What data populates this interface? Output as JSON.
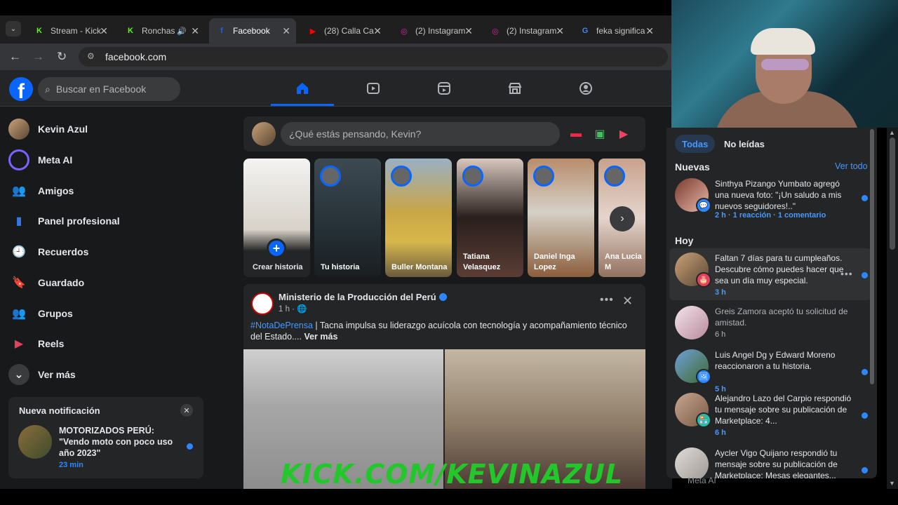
{
  "browser": {
    "tabs": [
      {
        "title": "Stream - Kick",
        "icon": "kick-icon",
        "icon_color": "#53fc18",
        "glyph": "K"
      },
      {
        "title": "Ronchas",
        "icon": "kick-icon",
        "icon_color": "#53fc18",
        "glyph": "K",
        "audio": "🔊"
      },
      {
        "title": "Facebook",
        "icon": "facebook-icon",
        "icon_color": "#0866ff",
        "glyph": "f"
      },
      {
        "title": "(28) Calla Ca",
        "icon": "youtube-icon",
        "icon_color": "#ff0000",
        "glyph": "▶"
      },
      {
        "title": "(2) Instagram",
        "icon": "instagram-icon",
        "icon_color": "#d6249f",
        "glyph": "◎"
      },
      {
        "title": "(2) Instagram",
        "icon": "instagram-icon",
        "icon_color": "#d6249f",
        "glyph": "◎"
      },
      {
        "title": "feka significa",
        "icon": "google-icon",
        "icon_color": "#4285f4",
        "glyph": "G"
      }
    ],
    "url": "facebook.com"
  },
  "fb": {
    "search_placeholder": "Buscar en Facebook",
    "logo_glyph": "f",
    "nav_icons": [
      "home-icon",
      "video-icon",
      "reels-icon",
      "marketplace-icon",
      "groups-icon"
    ]
  },
  "sidebar": {
    "items": [
      {
        "label": "Kevin Azul",
        "icon": "avatar",
        "glyph": ""
      },
      {
        "label": "Meta AI",
        "icon": "meta-ai-icon",
        "glyph": "◯"
      },
      {
        "label": "Amigos",
        "icon": "friends-icon",
        "glyph": "👥"
      },
      {
        "label": "Panel profesional",
        "icon": "dashboard-icon",
        "glyph": "▮"
      },
      {
        "label": "Recuerdos",
        "icon": "memories-icon",
        "glyph": "🕘"
      },
      {
        "label": "Guardado",
        "icon": "saved-icon",
        "glyph": "🔖"
      },
      {
        "label": "Grupos",
        "icon": "groups-icon",
        "glyph": "👥"
      },
      {
        "label": "Reels",
        "icon": "reels-icon",
        "glyph": "▶"
      },
      {
        "label": "Ver más",
        "icon": "chevron-down-icon",
        "glyph": "⌄"
      }
    ]
  },
  "toast": {
    "title": "Nueva notificación",
    "text": "MOTORIZADOS PERÚ: \"Vendo moto con poco uso año 2023\"",
    "time": "23 min"
  },
  "composer": {
    "placeholder": "¿Qué estás pensando, Kevin?"
  },
  "stories": [
    {
      "name": "Crear historia"
    },
    {
      "name": "Tu historia"
    },
    {
      "name": "Buller Montana"
    },
    {
      "name": "Tatiana Velasquez"
    },
    {
      "name": "Daniel Inga Lopez"
    },
    {
      "name": "Ana Lucia M"
    }
  ],
  "post": {
    "author": "Ministerio de la Producción del Perú",
    "time": "1 h · 🌐",
    "hashtag": "#NotaDePrensa",
    "body": " | Tacna impulsa su liderazgo acuícola con tecnología y acompañamiento técnico del Estado.... ",
    "more": "Ver más"
  },
  "watermark": "KICK.COM/KEVINAZUL",
  "notifications": {
    "filters": [
      "Todas",
      "No leídas"
    ],
    "section_new": "Nuevas",
    "see_all": "Ver todo",
    "section_today": "Hoy",
    "items": [
      {
        "text": "Sinthya Pizango Yumbato agregó una nueva foto: \"¡Un saludo a mis nuevos seguidores!..\"",
        "meta": "2 h · 1 reacción · 1 comentario",
        "unread": true,
        "badge": "💬",
        "badge_color": "#2d88ff"
      },
      {
        "text": "Faltan 7 días para tu cumpleaños. Descubre cómo puedes hacer que sea un día muy especial.",
        "meta": "3 h",
        "unread": true,
        "badge": "🎂",
        "badge_color": "#e4405f"
      },
      {
        "text": "Greis Zamora aceptó tu solicitud de amistad.",
        "meta": "6 h",
        "unread": false,
        "badge": "",
        "badge_color": ""
      },
      {
        "text": "Luis Angel Dg y Edward Moreno reaccionaron a tu historia.",
        "meta": "5 h",
        "unread": true,
        "badge": "🖼",
        "badge_color": "#2d88ff"
      },
      {
        "text": "Alejandro Lazo del Carpio respondió tu mensaje sobre su publicación de Marketplace: 4...",
        "meta": "6 h",
        "unread": true,
        "badge": "🏪",
        "badge_color": "#2abba7"
      },
      {
        "text": "Aycler Vigo Quijano respondió tu mensaje sobre su publicación de Marketplace: Mesas elegantes...",
        "meta": "",
        "unread": true,
        "badge": "",
        "badge_color": ""
      }
    ],
    "peek": "Meta AI"
  }
}
